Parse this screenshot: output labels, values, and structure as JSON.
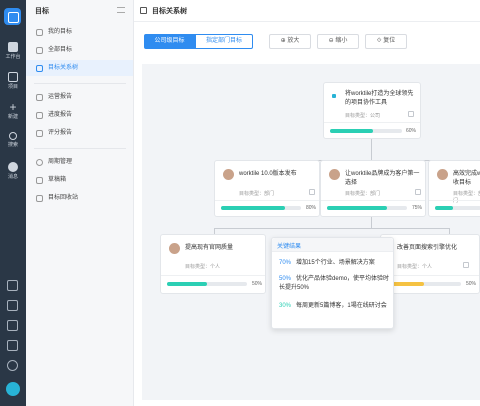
{
  "rail": {
    "items": [
      {
        "label": "工作台",
        "icon": "workbench-icon"
      },
      {
        "label": "项目",
        "icon": "project-icon"
      },
      {
        "label": "新建",
        "icon": "plus-icon"
      },
      {
        "label": "搜索",
        "icon": "search-icon"
      },
      {
        "label": "消息",
        "icon": "message-icon"
      }
    ]
  },
  "sidebar": {
    "title": "目标",
    "items": [
      {
        "label": "我的目标"
      },
      {
        "label": "全部目标"
      },
      {
        "label": "目标关系树"
      },
      {
        "label": "运营报告"
      },
      {
        "label": "进度报告"
      },
      {
        "label": "评分报告"
      },
      {
        "label": "周期管理"
      },
      {
        "label": "草稿箱"
      },
      {
        "label": "目标回收站"
      }
    ]
  },
  "header": {
    "title": "目标关系树"
  },
  "toolbar": {
    "tab_company": "公司级目标",
    "tab_dept": "指定部门目标",
    "zoom_in": "⊕ 放大",
    "zoom_out": "⊖ 缩小",
    "reset": "⟐ 复位"
  },
  "tree": {
    "root": {
      "title": "将worktile打造为全球领先的项目协作工具",
      "type": "目标类型：公司",
      "progress": 60,
      "pct": "60%"
    },
    "level2": [
      {
        "title": "worktile 10.0版本发布",
        "type": "目标类型：部门",
        "progress": 80,
        "pct": "80%"
      },
      {
        "title": "让worktile品牌成为客户第一选择",
        "type": "目标类型：部门",
        "progress": 75,
        "pct": "75%"
      },
      {
        "title": "高效完成w收目标",
        "type": "目标类型：部门"
      }
    ],
    "level3": [
      {
        "title": "提高现有官网质量",
        "type": "目标类型：个人",
        "progress": 50,
        "pct": "50%"
      },
      {
        "title": "改善页面搜索引擎优化",
        "type": "目标类型：个人",
        "progress": 50,
        "pct": "50%"
      }
    ]
  },
  "popup": {
    "title": "关键结果",
    "results": [
      {
        "pct": "70%",
        "text": "增加15个行业、场景解决方案"
      },
      {
        "pct": "50%",
        "text": "优化产品体验demo，使平均体验时长提升50%"
      },
      {
        "pct": "30%",
        "text": "每周更新5篇博客，1場在线研讨会"
      }
    ]
  },
  "colors": {
    "accent": "#2f8cf0",
    "progress": "#2bcfb4",
    "progress_alt": "#f5c242",
    "rail": "#2a3746"
  }
}
